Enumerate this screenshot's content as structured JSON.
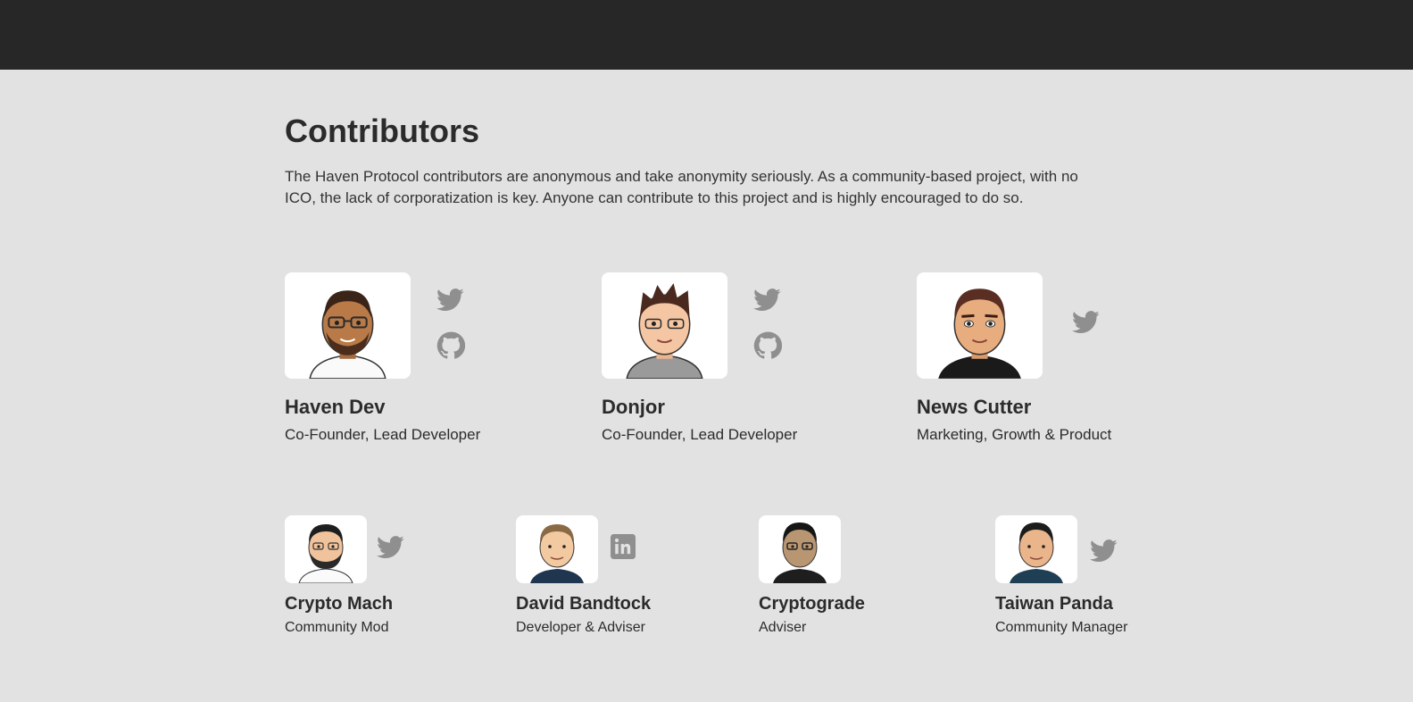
{
  "page": {
    "title": "Contributors",
    "intro": "The Haven Protocol contributors are anonymous and take anonymity seriously. As a community-based project, with no ICO, the lack of corporatization is key. Anyone can contribute to this project and is highly encouraged to do so."
  },
  "colors": {
    "topbar": "#272727",
    "background": "#e2e2e2",
    "text": "#2b2b2b",
    "icon": "#8f8f8f"
  },
  "contributors": [
    {
      "name": "Haven Dev",
      "role": "Co-Founder, Lead Developer",
      "icons": [
        "twitter-icon",
        "github-icon"
      ]
    },
    {
      "name": "Donjor",
      "role": "Co-Founder, Lead Developer",
      "icons": [
        "twitter-icon",
        "github-icon"
      ]
    },
    {
      "name": "News Cutter",
      "role": "Marketing, Growth & Product",
      "icons": [
        "twitter-icon"
      ]
    },
    {
      "name": "Crypto Mach",
      "role": "Community Mod",
      "icons": [
        "twitter-icon"
      ]
    },
    {
      "name": "David Bandtock",
      "role": "Developer & Adviser",
      "icons": [
        "linkedin-icon"
      ]
    },
    {
      "name": "Cryptograde",
      "role": "Adviser",
      "icons": []
    },
    {
      "name": "Taiwan Panda",
      "role": "Community Manager",
      "icons": [
        "twitter-icon"
      ]
    }
  ]
}
